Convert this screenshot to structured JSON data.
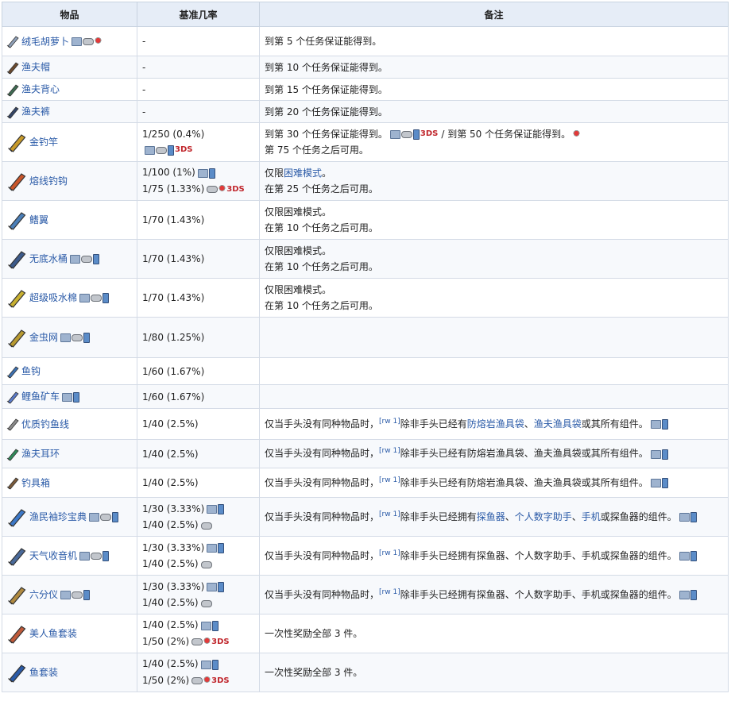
{
  "header": {
    "item": "物品",
    "rate": "基准几率",
    "notes": "备注"
  },
  "platform_icon_names": {
    "pc": "desktop-platform-icon",
    "con": "console-platform-icon",
    "mob": "mobile-platform-icon",
    "old": "old-gen-console-icon",
    "ds": "3ds-platform-icon"
  },
  "ds_label": "3DS",
  "rows": [
    {
      "name": "绒毛胡萝卜",
      "icon": "fuzzy-carrot-icon",
      "plats": "pc,con,old",
      "rates": [
        "-"
      ],
      "notes": [
        "到第 5 个任务保证能得到。"
      ]
    },
    {
      "name": "渔夫帽",
      "icon": "angler-hat-icon",
      "plats": "",
      "rates": [
        "-"
      ],
      "notes": [
        "到第 10 个任务保证能得到。"
      ]
    },
    {
      "name": "渔夫背心",
      "icon": "angler-vest-icon",
      "plats": "",
      "rates": [
        "-"
      ],
      "notes": [
        "到第 15 个任务保证能得到。"
      ]
    },
    {
      "name": "渔夫裤",
      "icon": "angler-pants-icon",
      "plats": "",
      "rates": [
        "-"
      ],
      "notes": [
        "到第 20 个任务保证能得到。"
      ]
    },
    {
      "name": "金钓竿",
      "icon": "golden-fishing-rod-icon",
      "plats": "",
      "rates": [
        "1/250 (0.4%)"
      ],
      "notes": [
        "到第 30 个任务保证能得到。",
        "/ 到第 50 个任务保证能得到。",
        "第 75 个任务之后可用。"
      ]
    },
    {
      "name": "熔线钓钩",
      "icon": "hotline-fishing-hook-icon",
      "plats": "",
      "rates": [
        "1/100 (1%)",
        "1/75 (1.33%)"
      ],
      "notes": [
        "仅限",
        "困难模式",
        "。",
        "在第 25 个任务之后可用。"
      ]
    },
    {
      "name": "鳍翼",
      "icon": "fin-wings-icon",
      "plats": "",
      "rates": [
        "1/70 (1.43%)"
      ],
      "notes": [
        "仅限困难模式。",
        "在第 10 个任务之后可用。"
      ]
    },
    {
      "name": "无底水桶",
      "icon": "bottomless-bucket-icon",
      "plats": "pc,con,mob",
      "rates": [
        "1/70 (1.43%)"
      ],
      "notes": [
        "仅限困难模式。",
        "在第 10 个任务之后可用。"
      ]
    },
    {
      "name": "超级吸水棉",
      "icon": "super-absorbant-sponge-icon",
      "plats": "pc,con,mob",
      "rates": [
        "1/70 (1.43%)"
      ],
      "notes": [
        "仅限困难模式。",
        "在第 10 个任务之后可用。"
      ]
    },
    {
      "name": "金虫网",
      "icon": "golden-bug-net-icon",
      "plats": "pc,con,mob",
      "rates": [
        "1/80 (1.25%)"
      ],
      "notes": []
    },
    {
      "name": "鱼钩",
      "icon": "fish-hook-icon",
      "plats": "",
      "rates": [
        "1/60 (1.67%)"
      ],
      "notes": []
    },
    {
      "name": "鲤鱼矿车",
      "icon": "minecarp-icon",
      "plats": "pc,mob",
      "rates": [
        "1/60 (1.67%)"
      ],
      "notes": []
    },
    {
      "name": "优质钓鱼线",
      "icon": "high-test-fishing-line-icon",
      "plats": "",
      "rates": [
        "1/40 (2.5%)"
      ],
      "notes": [
        "仅当手头没有同种物品时，",
        "[rw 1]",
        "除非手头已经有",
        "防熔岩渔具袋",
        "、",
        "渔夫渔具袋",
        "或其所有组件。"
      ]
    },
    {
      "name": "渔夫耳环",
      "icon": "anglers-earring-icon",
      "plats": "",
      "rates": [
        "1/40 (2.5%)"
      ],
      "notes": [
        "仅当手头没有同种物品时，",
        "[rw 1]",
        "除非手头已经有防熔岩渔具袋、渔夫渔具袋或其所有组件。"
      ]
    },
    {
      "name": "钓具箱",
      "icon": "tackle-box-icon",
      "plats": "",
      "rates": [
        "1/40 (2.5%)"
      ],
      "notes": [
        "仅当手头没有同种物品时，",
        "[rw 1]",
        "除非手头已经有防熔岩渔具袋、渔夫渔具袋或其所有组件。"
      ]
    },
    {
      "name": "渔民袖珍宝典",
      "icon": "fishermans-pocket-guide-icon",
      "plats": "pc,con,mob",
      "rates": [
        "1/30 (3.33%)",
        "1/40 (2.5%)"
      ],
      "notes": [
        "仅当手头没有同种物品时，",
        "[rw 1]",
        "除非手头已经拥有",
        "探鱼器",
        "、",
        "个人数字助手",
        "、",
        "手机",
        "或探鱼器的组件。"
      ]
    },
    {
      "name": "天气收音机",
      "icon": "weather-radio-icon",
      "plats": "pc,con,mob",
      "rates": [
        "1/30 (3.33%)",
        "1/40 (2.5%)"
      ],
      "notes": [
        "仅当手头没有同种物品时，",
        "[rw 1]",
        "除非手头已经拥有探鱼器、个人数字助手、手机或探鱼器的组件。"
      ]
    },
    {
      "name": "六分仪",
      "icon": "sextant-icon",
      "plats": "pc,con,mob",
      "rates": [
        "1/30 (3.33%)",
        "1/40 (2.5%)"
      ],
      "notes": [
        "仅当手头没有同种物品时，",
        "[rw 1]",
        "除非手头已经拥有探鱼器、个人数字助手、手机或探鱼器的组件。"
      ]
    },
    {
      "name": "美人鱼套装",
      "icon": "mermaid-costume-icon",
      "plats": "",
      "rates": [
        "1/40 (2.5%)",
        "1/50 (2%)"
      ],
      "notes": [
        "一次性奖励全部 3 件。"
      ]
    },
    {
      "name": "鱼套装",
      "icon": "fish-costume-icon",
      "plats": "",
      "rates": [
        "1/40 (2.5%)",
        "1/50 (2%)"
      ],
      "notes": [
        "一次性奖励全部 3 件。"
      ]
    }
  ]
}
